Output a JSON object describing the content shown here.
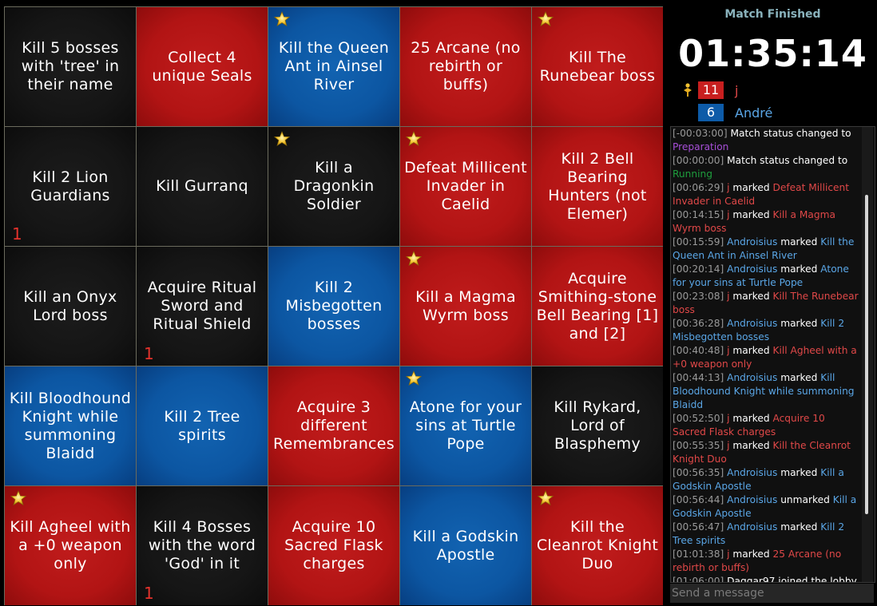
{
  "board": {
    "cells": [
      {
        "text": "Kill 5 bosses with 'tree' in their name",
        "color": "black",
        "star": false,
        "marker": ""
      },
      {
        "text": "Collect 4 unique Seals",
        "color": "red",
        "star": false,
        "marker": ""
      },
      {
        "text": "Kill the Queen Ant in Ainsel River",
        "color": "blue",
        "star": true,
        "marker": ""
      },
      {
        "text": "25 Arcane (no rebirth or buffs)",
        "color": "red",
        "star": false,
        "marker": ""
      },
      {
        "text": "Kill The Runebear boss",
        "color": "red",
        "star": true,
        "marker": ""
      },
      {
        "text": "Kill 2 Lion Guardians",
        "color": "black",
        "star": false,
        "marker": "1"
      },
      {
        "text": "Kill Gurranq",
        "color": "black",
        "star": false,
        "marker": ""
      },
      {
        "text": "Kill a Dragonkin Soldier",
        "color": "black",
        "star": true,
        "marker": ""
      },
      {
        "text": "Defeat Millicent Invader in Caelid",
        "color": "red",
        "star": true,
        "marker": ""
      },
      {
        "text": "Kill 2 Bell Bearing Hunters (not Elemer)",
        "color": "red",
        "star": false,
        "marker": ""
      },
      {
        "text": "Kill an Onyx Lord boss",
        "color": "black",
        "star": false,
        "marker": ""
      },
      {
        "text": "Acquire Ritual Sword and Ritual Shield",
        "color": "black",
        "star": false,
        "marker": "1"
      },
      {
        "text": "Kill 2 Misbegotten bosses",
        "color": "blue",
        "star": false,
        "marker": ""
      },
      {
        "text": "Kill a Magma Wyrm boss",
        "color": "red",
        "star": true,
        "marker": ""
      },
      {
        "text": "Acquire Smithing-stone Bell Bearing [1] and [2]",
        "color": "red",
        "star": false,
        "marker": ""
      },
      {
        "text": "Kill Bloodhound Knight while summoning Blaidd",
        "color": "blue",
        "star": false,
        "marker": ""
      },
      {
        "text": "Kill 2 Tree spirits",
        "color": "blue",
        "star": false,
        "marker": ""
      },
      {
        "text": "Acquire 3 different Remembrances",
        "color": "red",
        "star": false,
        "marker": ""
      },
      {
        "text": "Atone for your sins at Turtle Pope",
        "color": "blue",
        "star": true,
        "marker": ""
      },
      {
        "text": "Kill Rykard, Lord of Blasphemy",
        "color": "black",
        "star": false,
        "marker": ""
      },
      {
        "text": "Kill Agheel with a +0 weapon only",
        "color": "red",
        "star": true,
        "marker": ""
      },
      {
        "text": "Kill 4 Bosses with the word 'God' in it",
        "color": "black",
        "star": false,
        "marker": "1"
      },
      {
        "text": "Acquire 10 Sacred Flask charges",
        "color": "red",
        "star": false,
        "marker": ""
      },
      {
        "text": "Kill a Godskin Apostle",
        "color": "blue",
        "star": false,
        "marker": ""
      },
      {
        "text": "Kill the Cleanrot Knight Duo",
        "color": "red",
        "star": true,
        "marker": ""
      }
    ]
  },
  "sidebar": {
    "status": "Match Finished",
    "timer": "01:35:14",
    "teams": [
      {
        "score": "11",
        "name": "j",
        "color": "#c81f1f",
        "name_color": "#e04848",
        "leader": true
      },
      {
        "score": "6",
        "name": "André",
        "color": "#0d5ba8",
        "name_color": "#5aa6e6",
        "leader": false
      }
    ]
  },
  "log": {
    "lines": [
      [
        {
          "t": "[-00:03:00] ",
          "c": "ts"
        },
        {
          "t": "Match status changed to ",
          "c": "w"
        },
        {
          "t": "Preparation",
          "c": "c-purple"
        }
      ],
      [
        {
          "t": "[00:00:00] ",
          "c": "ts"
        },
        {
          "t": "Match status changed to ",
          "c": "w"
        },
        {
          "t": "Running",
          "c": "c-green"
        }
      ],
      [
        {
          "t": "[00:06:29] ",
          "c": "ts"
        },
        {
          "t": "j",
          "c": "c-red"
        },
        {
          "t": " marked ",
          "c": "w"
        },
        {
          "t": "Defeat Millicent Invader in Caelid",
          "c": "c-red"
        }
      ],
      [
        {
          "t": "[00:14:15] ",
          "c": "ts"
        },
        {
          "t": "j",
          "c": "c-red"
        },
        {
          "t": " marked ",
          "c": "w"
        },
        {
          "t": "Kill a Magma Wyrm boss",
          "c": "c-red"
        }
      ],
      [
        {
          "t": "[00:15:59] ",
          "c": "ts"
        },
        {
          "t": "Androisius",
          "c": "c-blue"
        },
        {
          "t": " marked ",
          "c": "w"
        },
        {
          "t": "Kill the Queen Ant in Ainsel River",
          "c": "c-blue"
        }
      ],
      [
        {
          "t": "[00:20:14] ",
          "c": "ts"
        },
        {
          "t": "Androisius",
          "c": "c-blue"
        },
        {
          "t": " marked ",
          "c": "w"
        },
        {
          "t": "Atone for your sins at Turtle Pope",
          "c": "c-blue"
        }
      ],
      [
        {
          "t": "[00:23:08] ",
          "c": "ts"
        },
        {
          "t": "j",
          "c": "c-red"
        },
        {
          "t": " marked ",
          "c": "w"
        },
        {
          "t": "Kill The Runebear boss",
          "c": "c-red"
        }
      ],
      [
        {
          "t": "[00:36:28] ",
          "c": "ts"
        },
        {
          "t": "Androisius",
          "c": "c-blue"
        },
        {
          "t": " marked ",
          "c": "w"
        },
        {
          "t": "Kill 2 Misbegotten bosses",
          "c": "c-blue"
        }
      ],
      [
        {
          "t": "[00:40:48] ",
          "c": "ts"
        },
        {
          "t": "j",
          "c": "c-red"
        },
        {
          "t": " marked ",
          "c": "w"
        },
        {
          "t": "Kill Agheel with a +0 weapon only",
          "c": "c-red"
        }
      ],
      [
        {
          "t": "[00:44:13] ",
          "c": "ts"
        },
        {
          "t": "Androisius",
          "c": "c-blue"
        },
        {
          "t": " marked ",
          "c": "w"
        },
        {
          "t": "Kill Bloodhound Knight while summoning Blaidd",
          "c": "c-blue"
        }
      ],
      [
        {
          "t": "[00:52:50] ",
          "c": "ts"
        },
        {
          "t": "j",
          "c": "c-red"
        },
        {
          "t": " marked ",
          "c": "w"
        },
        {
          "t": "Acquire 10 Sacred Flask charges",
          "c": "c-red"
        }
      ],
      [
        {
          "t": "[00:55:35] ",
          "c": "ts"
        },
        {
          "t": "j",
          "c": "c-red"
        },
        {
          "t": " marked ",
          "c": "w"
        },
        {
          "t": "Kill the Cleanrot Knight Duo",
          "c": "c-red"
        }
      ],
      [
        {
          "t": "[00:56:35] ",
          "c": "ts"
        },
        {
          "t": "Androisius",
          "c": "c-blue"
        },
        {
          "t": " marked ",
          "c": "w"
        },
        {
          "t": "Kill a Godskin Apostle",
          "c": "c-blue"
        }
      ],
      [
        {
          "t": "[00:56:44] ",
          "c": "ts"
        },
        {
          "t": "Androisius",
          "c": "c-blue"
        },
        {
          "t": " unmarked ",
          "c": "w"
        },
        {
          "t": "Kill a Godskin Apostle",
          "c": "c-blue"
        }
      ],
      [
        {
          "t": "[00:56:47] ",
          "c": "ts"
        },
        {
          "t": "Androisius",
          "c": "c-blue"
        },
        {
          "t": " marked ",
          "c": "w"
        },
        {
          "t": "Kill 2 Tree spirits",
          "c": "c-blue"
        }
      ],
      [
        {
          "t": "[01:01:38] ",
          "c": "ts"
        },
        {
          "t": "j",
          "c": "c-red"
        },
        {
          "t": " marked ",
          "c": "w"
        },
        {
          "t": "25 Arcane (no rebirth or buffs)",
          "c": "c-red"
        }
      ],
      [
        {
          "t": "[01:06:00] ",
          "c": "ts"
        },
        {
          "t": "Daggar97 joined the lobby",
          "c": "w"
        }
      ]
    ]
  },
  "chat": {
    "placeholder": "Send a message"
  }
}
